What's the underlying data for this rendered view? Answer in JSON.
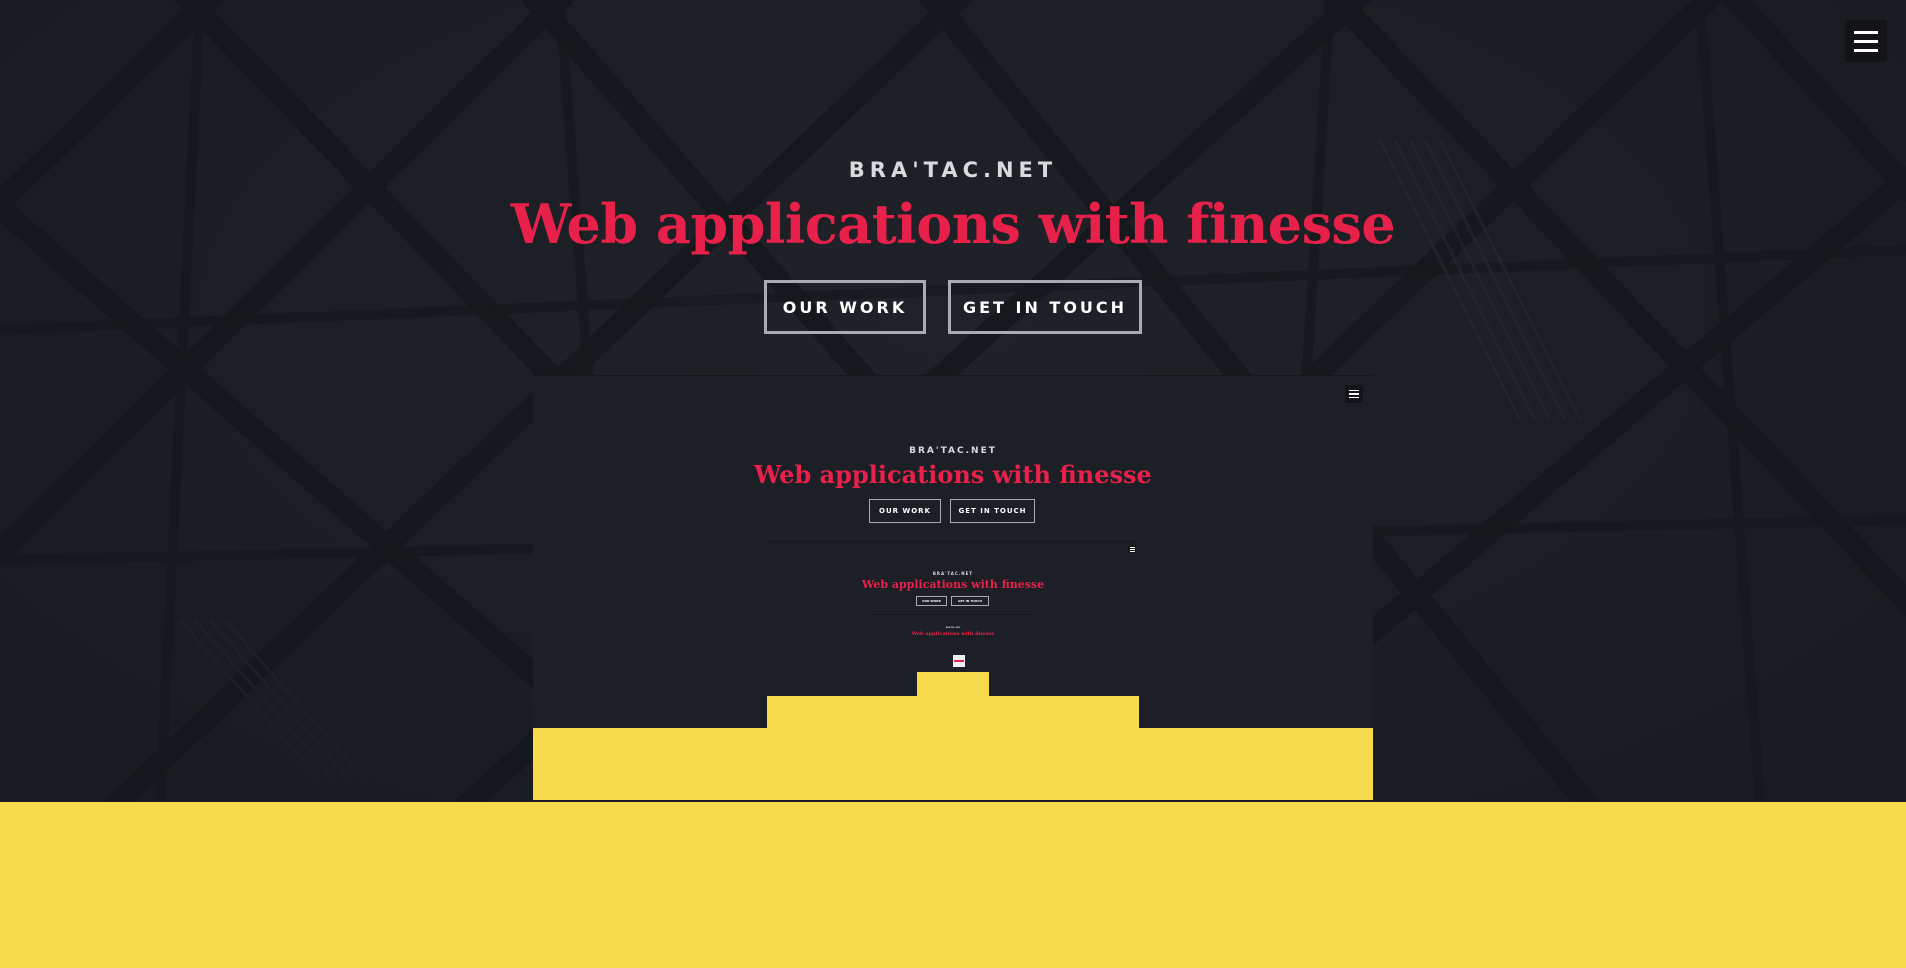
{
  "site": {
    "brand": "BRA'TAC.NET",
    "headline": "Web applications with finesse"
  },
  "actions": {
    "our_work_label": "OUR WORK",
    "get_in_touch_label": "GET IN TOUCH"
  },
  "menu": {
    "icon": "hamburger-menu-icon"
  },
  "colors": {
    "background": "#1c1f25",
    "accent": "#e8214a",
    "yellow": "#f8da4e",
    "button_border": "#a9abb0",
    "brand_text": "#d9dade"
  }
}
